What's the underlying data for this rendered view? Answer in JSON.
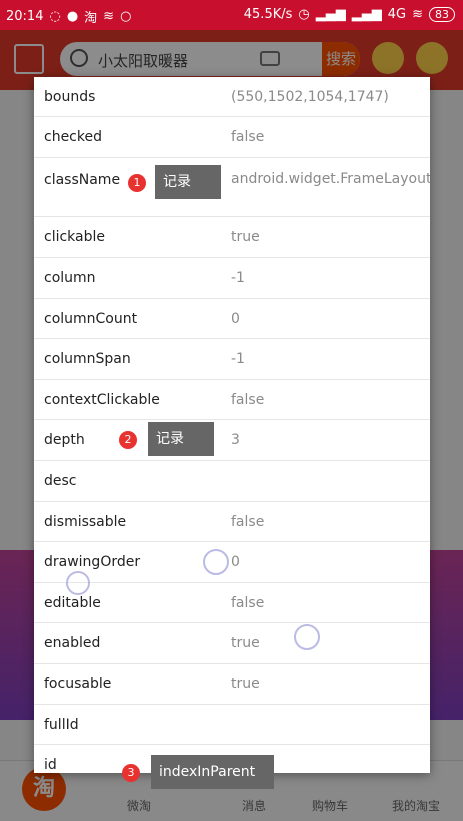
{
  "status_bar": {
    "time": "20:14",
    "network_speed": "45.5K/s",
    "network_type": "4G",
    "battery": "83"
  },
  "app": {
    "search_placeholder": "小太阳取暖器",
    "search_button": "搜索",
    "nav": [
      "微淘",
      "消息",
      "购物车",
      "我的淘宝"
    ],
    "home_glyph": "淘"
  },
  "properties": [
    {
      "name": "bounds",
      "value": "(550,1502,1054,1747)"
    },
    {
      "name": "checked",
      "value": "false"
    },
    {
      "name": "className",
      "value": "android.widget.FrameLayout"
    },
    {
      "name": "clickable",
      "value": "true"
    },
    {
      "name": "column",
      "value": "-1"
    },
    {
      "name": "columnCount",
      "value": "0"
    },
    {
      "name": "columnSpan",
      "value": "-1"
    },
    {
      "name": "contextClickable",
      "value": "false"
    },
    {
      "name": "depth",
      "value": "3"
    },
    {
      "name": "desc",
      "value": ""
    },
    {
      "name": "dismissable",
      "value": "false"
    },
    {
      "name": "drawingOrder",
      "value": "0"
    },
    {
      "name": "editable",
      "value": "false"
    },
    {
      "name": "enabled",
      "value": "true"
    },
    {
      "name": "focusable",
      "value": "true"
    },
    {
      "name": "fullId",
      "value": ""
    },
    {
      "name": "id",
      "value": ""
    }
  ],
  "annotations": [
    {
      "number": "1",
      "label": "记录"
    },
    {
      "number": "2",
      "label": "记录"
    },
    {
      "number": "3",
      "label": "indexInParent"
    }
  ]
}
